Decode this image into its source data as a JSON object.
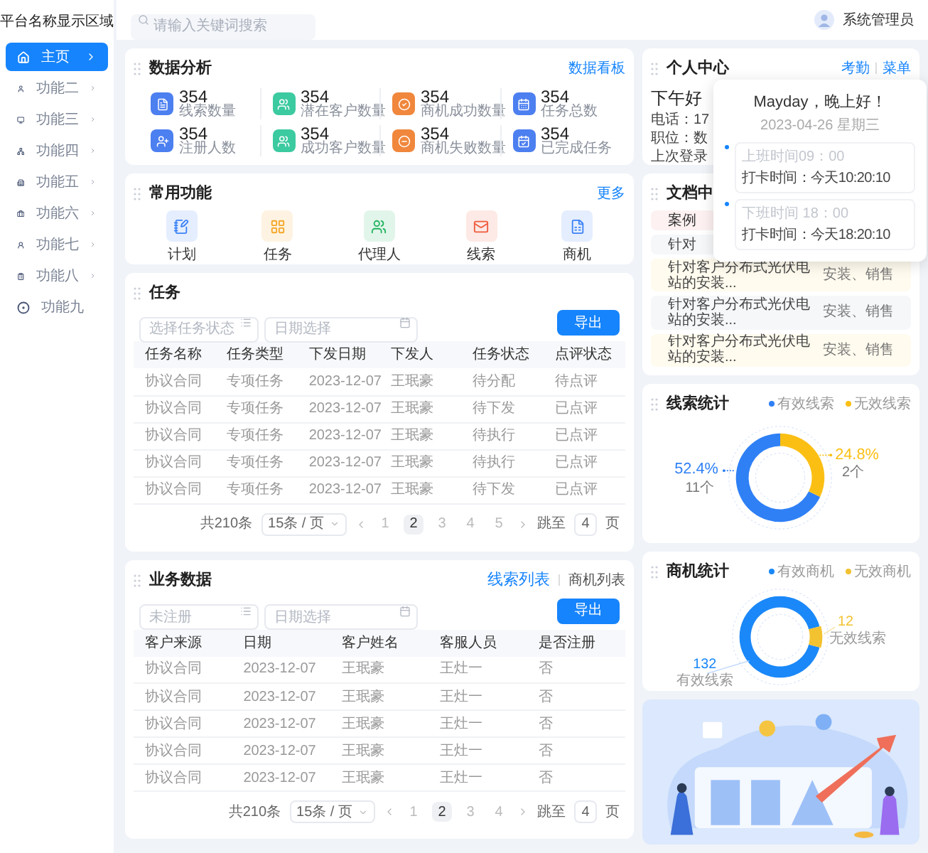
{
  "sidebar": {
    "title": "平台名称显示区域",
    "items": [
      {
        "label": "主页",
        "selected": true,
        "expandable": true
      },
      {
        "label": "功能二",
        "selected": false,
        "expandable": true
      },
      {
        "label": "功能三",
        "selected": false,
        "expandable": true
      },
      {
        "label": "功能四",
        "selected": false,
        "expandable": true
      },
      {
        "label": "功能五",
        "selected": false,
        "expandable": true
      },
      {
        "label": "功能六",
        "selected": false,
        "expandable": true
      },
      {
        "label": "功能七",
        "selected": false,
        "expandable": true
      },
      {
        "label": "功能八",
        "selected": false,
        "expandable": true
      },
      {
        "label": "功能九",
        "selected": false,
        "expandable": false
      }
    ]
  },
  "topbar": {
    "search": {
      "placeholder": "请输入关键词搜索"
    },
    "user": "系统管理员"
  },
  "data_analysis": {
    "title": "数据分析",
    "link": "数据看板",
    "stats": [
      {
        "value": "354",
        "label": "线索数量",
        "color": "#4c7ff0"
      },
      {
        "value": "354",
        "label": "潜在客户数量",
        "color": "#3ccaa0"
      },
      {
        "value": "354",
        "label": "商机成功数量",
        "color": "#f0873c"
      },
      {
        "value": "354",
        "label": "任务总数",
        "color": "#4c7ff0"
      },
      {
        "value": "354",
        "label": "注册人数",
        "color": "#4c7ff0"
      },
      {
        "value": "354",
        "label": "成功客户数量",
        "color": "#3ccaa0"
      },
      {
        "value": "354",
        "label": "商机失败数量",
        "color": "#f0873c"
      },
      {
        "value": "354",
        "label": "已完成任务",
        "color": "#4c7ff0"
      }
    ]
  },
  "common": {
    "title": "常用功能",
    "link": "更多",
    "items": [
      {
        "label": "计划",
        "color": "#3b82f6"
      },
      {
        "label": "任务",
        "color": "#f5a524"
      },
      {
        "label": "代理人",
        "color": "#22b35e"
      },
      {
        "label": "线索",
        "color": "#ef5a3c"
      },
      {
        "label": "商机",
        "color": "#3b82f6"
      }
    ]
  },
  "tasks": {
    "title": "任务",
    "filters": [
      {
        "placeholder": "选择任务状态"
      },
      {
        "placeholder": "日期选择"
      }
    ],
    "export": "导出",
    "columns": [
      "任务名称",
      "任务类型",
      "下发日期",
      "下发人",
      "任务状态",
      "点评状态"
    ],
    "rows": [
      [
        "协议合同",
        "专项任务",
        "2023-12-07",
        "王珉豪",
        "待分配",
        "待点评"
      ],
      [
        "协议合同",
        "专项任务",
        "2023-12-07",
        "王珉豪",
        "待下发",
        "已点评"
      ],
      [
        "协议合同",
        "专项任务",
        "2023-12-07",
        "王珉豪",
        "待执行",
        "已点评"
      ],
      [
        "协议合同",
        "专项任务",
        "2023-12-07",
        "王珉豪",
        "待执行",
        "已点评"
      ],
      [
        "协议合同",
        "专项任务",
        "2023-12-07",
        "王珉豪",
        "待下发",
        "已点评"
      ]
    ],
    "pagination": {
      "total": "共210条",
      "page_size": "15条 / 页",
      "pages": [
        {
          "label": "1",
          "selected": false
        },
        {
          "label": "2",
          "selected": true
        },
        {
          "label": "3",
          "selected": false
        },
        {
          "label": "4",
          "selected": false
        },
        {
          "label": "5",
          "selected": false
        }
      ],
      "jump_label": "跳至",
      "jump_value": "4",
      "jump_unit": "页"
    }
  },
  "business": {
    "title": "业务数据",
    "tabs": [
      {
        "label": "线索列表",
        "selected": true
      },
      {
        "label": "商机列表",
        "selected": false
      }
    ],
    "filters": [
      {
        "placeholder": "未注册"
      },
      {
        "placeholder": "日期选择"
      }
    ],
    "export": "导出",
    "columns": [
      "客户来源",
      "日期",
      "客户姓名",
      "客服人员",
      "是否注册"
    ],
    "rows": [
      [
        "协议合同",
        "2023-12-07",
        "王珉豪",
        "王灶一",
        "否"
      ],
      [
        "协议合同",
        "2023-12-07",
        "王珉豪",
        "王灶一",
        "否"
      ],
      [
        "协议合同",
        "2023-12-07",
        "王珉豪",
        "王灶一",
        "否"
      ],
      [
        "协议合同",
        "2023-12-07",
        "王珉豪",
        "王灶一",
        "否"
      ],
      [
        "协议合同",
        "2023-12-07",
        "王珉豪",
        "王灶一",
        "否"
      ]
    ],
    "pagination": {
      "total": "共210条",
      "page_size": "15条 / 页",
      "pages": [
        {
          "label": "1",
          "selected": false
        },
        {
          "label": "2",
          "selected": true
        },
        {
          "label": "3",
          "selected": false
        },
        {
          "label": "4",
          "selected": false
        }
      ],
      "jump_label": "跳至",
      "jump_value": "4",
      "jump_unit": "页"
    }
  },
  "personal": {
    "title": "个人中心",
    "links": [
      "考勤",
      "菜单"
    ],
    "greeting": "下午好",
    "lines": [
      "电话：17",
      "职位：数",
      "上次登录"
    ]
  },
  "popup": {
    "title": "Mayday，晚上好！",
    "date": "2023-04-26 星期三",
    "entries": [
      {
        "time": "上班时间09：00",
        "punch": "打卡时间：今天10:20:10"
      },
      {
        "time": "下班时间 18：00",
        "punch": "打卡时间：今天18:20:10"
      }
    ]
  },
  "documents": {
    "title": "文档中",
    "header": "案例",
    "partial_row": "针对",
    "rows": [
      {
        "title": "针对客户分布式光伏电站的安装...",
        "tags": "安装、销售"
      },
      {
        "title": "针对客户分布式光伏电站的安装...",
        "tags": "安装、销售"
      },
      {
        "title": "针对客户分布式光伏电站的安装...",
        "tags": "安装、销售"
      }
    ]
  },
  "leads": {
    "title": "线索统计",
    "legend": [
      {
        "color": "#2f80f5"
      },
      {
        "color": "#fbbf14"
      }
    ],
    "chart_data": {
      "type": "donut",
      "categories": [
        "有效线索",
        "无效线索"
      ],
      "values": [
        52.4,
        24.8
      ],
      "value_labels": [
        "52.4%",
        "24.8%"
      ],
      "annotations": [
        "11个",
        "2个"
      ]
    }
  },
  "opportunities": {
    "title": "商机统计",
    "legend": [
      {
        "color": "#1a88f8"
      },
      {
        "color": "#f2c230"
      }
    ],
    "chart_data": {
      "type": "donut",
      "categories": [
        "有效商机",
        "无效商机"
      ],
      "values": [
        132,
        12
      ],
      "value_labels": [
        "132",
        "12"
      ],
      "annotations": [
        "有效线索",
        "无效线索"
      ]
    }
  }
}
